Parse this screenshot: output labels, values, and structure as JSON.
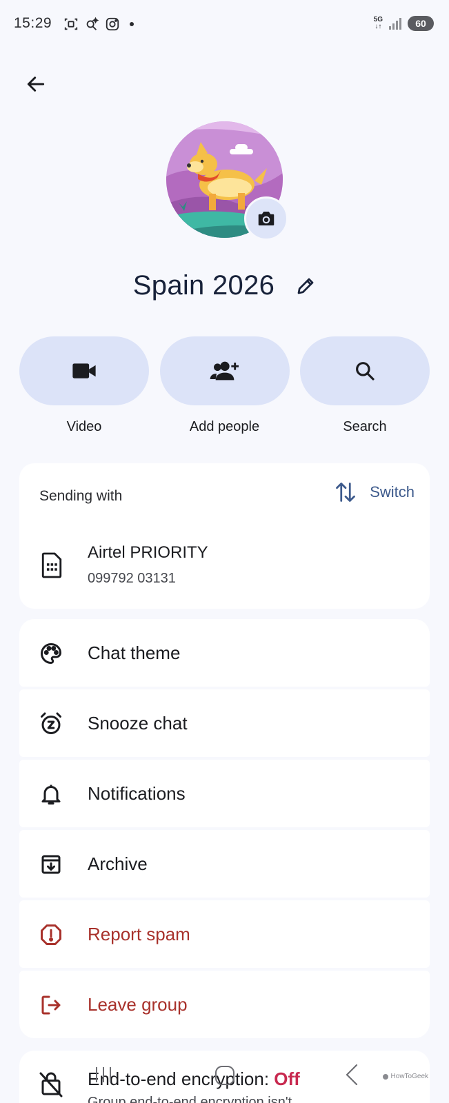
{
  "status_bar": {
    "time": "15:29",
    "network": "5G",
    "battery": "60",
    "icons": [
      "screenshot-icon",
      "sparkle-search-icon",
      "instagram-icon",
      "dot-icon",
      "signal-icon"
    ]
  },
  "header": {
    "back_icon": "arrow-left-icon"
  },
  "group": {
    "name": "Spain 2026",
    "avatar_icon": "corgi-avatar",
    "camera_icon": "camera-icon",
    "edit_icon": "pencil-icon"
  },
  "actions": [
    {
      "label": "Video",
      "icon": "videocam-icon"
    },
    {
      "label": "Add people",
      "icon": "add-person-icon"
    },
    {
      "label": "Search",
      "icon": "search-icon"
    }
  ],
  "sending": {
    "label": "Sending with",
    "switch_label": "Switch",
    "sim_name": "Airtel PRIORITY",
    "sim_number": "099792 03131"
  },
  "menu": [
    {
      "label": "Chat theme",
      "icon": "palette-icon"
    },
    {
      "label": "Snooze chat",
      "icon": "snooze-icon"
    },
    {
      "label": "Notifications",
      "icon": "bell-icon"
    },
    {
      "label": "Archive",
      "icon": "archive-icon"
    },
    {
      "label": "Report spam",
      "icon": "report-icon"
    },
    {
      "label": "Leave group",
      "icon": "leave-icon"
    }
  ],
  "encryption": {
    "label": "End-to-end encryption: ",
    "status": "Off",
    "sub": "Group end-to-end encryption isn't"
  },
  "watermark": "HowToGeek",
  "colors": {
    "accent": "#3d5a8c",
    "pill": "#dce3f8",
    "danger": "#a8312b",
    "off": "#c8294f",
    "background": "#f7f8fd"
  }
}
